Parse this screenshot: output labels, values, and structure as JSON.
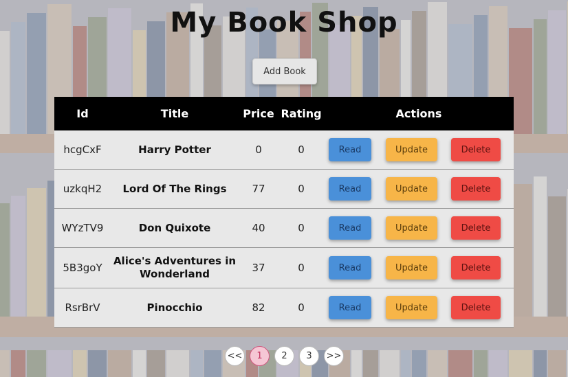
{
  "page": {
    "title": "My Book Shop"
  },
  "toolbar": {
    "add_label": "Add Book"
  },
  "table": {
    "headers": [
      "Id",
      "Title",
      "Price",
      "Rating",
      "Actions"
    ],
    "rows": [
      {
        "id": "hcgCxF",
        "title": "Harry Potter",
        "price": "0",
        "rating": "0"
      },
      {
        "id": "uzkqH2",
        "title": "Lord Of The Rings",
        "price": "77",
        "rating": "0"
      },
      {
        "id": "WYzTV9",
        "title": "Don Quixote",
        "price": "40",
        "rating": "0"
      },
      {
        "id": "5B3goY",
        "title": "Alice's Adventures in Wonderland",
        "price": "37",
        "rating": "0"
      },
      {
        "id": "RsrBrV",
        "title": "Pinocchio",
        "price": "82",
        "rating": "0"
      }
    ],
    "actions": {
      "read": "Read",
      "update": "Update",
      "delete": "Delete"
    }
  },
  "pagination": {
    "prev": "<<",
    "pages": [
      "1",
      "2",
      "3"
    ],
    "next": ">>",
    "current": "1"
  },
  "colors": {
    "read": "#4a90d9",
    "update": "#f7b548",
    "delete": "#ef4b45",
    "header": "#000000",
    "active_page": "#f5c6d4"
  }
}
